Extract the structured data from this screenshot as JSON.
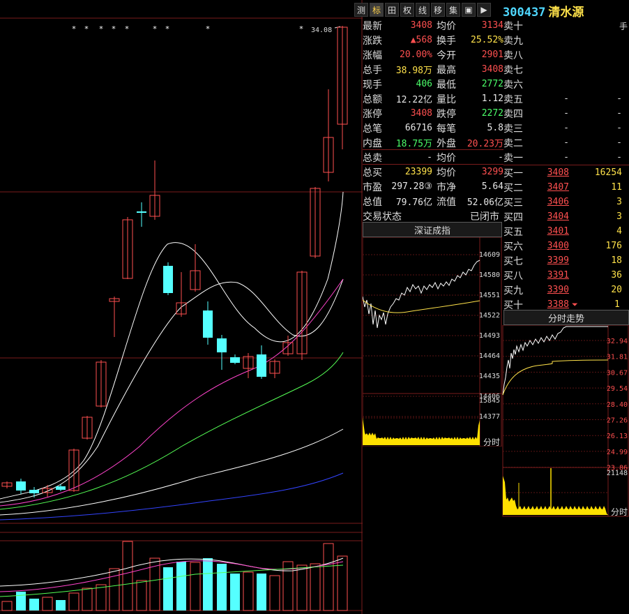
{
  "toolbar": {
    "tabs": [
      "测",
      "标",
      "田",
      "权",
      "线",
      "移",
      "集",
      "▣",
      "▶"
    ],
    "active_tab": "标"
  },
  "stock": {
    "code": "300437",
    "name": "清水源",
    "unit": "手"
  },
  "main_chart": {
    "price_label": "34.08",
    "markers": [
      "*",
      "*",
      "*",
      "*",
      "*",
      "*",
      "*",
      "*",
      "*"
    ]
  },
  "quote": {
    "rows": [
      {
        "l1": "最新",
        "v1": "3408",
        "c1": "red",
        "l2": "均价",
        "v2": "3134",
        "c2": "red"
      },
      {
        "l1": "涨跌",
        "v1": "▲568",
        "c1": "red",
        "l2": "换手",
        "v2": "25.52%",
        "c2": "yellow"
      },
      {
        "l1": "涨幅",
        "v1": "20.00%",
        "c1": "red",
        "l2": "今开",
        "v2": "2901",
        "c2": "red"
      },
      {
        "l1": "总手",
        "v1": "38.98万",
        "c1": "yellow",
        "l2": "最高",
        "v2": "3408",
        "c2": "red"
      },
      {
        "l1": "现手",
        "v1": "406",
        "c1": "green",
        "l2": "最低",
        "v2": "2772",
        "c2": "green"
      },
      {
        "l1": "总额",
        "v1": "12.22亿",
        "c1": "white",
        "l2": "量比",
        "v2": "1.12",
        "c2": "white"
      },
      {
        "l1": "涨停",
        "v1": "3408",
        "c1": "red",
        "l2": "跌停",
        "v2": "2272",
        "c2": "green"
      },
      {
        "l1": "总笔",
        "v1": "66716",
        "c1": "white",
        "l2": "每笔",
        "v2": "5.8",
        "c2": "white"
      },
      {
        "l1": "内盘",
        "v1": "18.75万",
        "c1": "green",
        "l2": "外盘",
        "v2": "20.23万",
        "c2": "red"
      },
      {
        "l1": "总卖",
        "v1": "-",
        "c1": "white",
        "l2": "均价",
        "v2": "-",
        "c2": "white"
      },
      {
        "l1": "总买",
        "v1": "23399",
        "c1": "yellow",
        "l2": "均价",
        "v2": "3299",
        "c2": "red"
      },
      {
        "l1": "市盈",
        "v1": "297.28③",
        "c1": "white",
        "l2": "市净",
        "v2": "5.64",
        "c2": "white"
      },
      {
        "l1": "总值",
        "v1": "79.76亿",
        "c1": "white",
        "l2": "流值",
        "v2": "52.06亿",
        "c2": "white"
      }
    ],
    "trade_state_label": "交易状态",
    "trade_state_value": "已闭市"
  },
  "orderbook": {
    "sell": [
      {
        "label": "卖十",
        "price": "",
        "vol": ""
      },
      {
        "label": "卖九",
        "price": "",
        "vol": ""
      },
      {
        "label": "卖八",
        "price": "",
        "vol": ""
      },
      {
        "label": "卖七",
        "price": "",
        "vol": ""
      },
      {
        "label": "卖六",
        "price": "",
        "vol": ""
      },
      {
        "label": "卖五",
        "price": "-",
        "vol": "-"
      },
      {
        "label": "卖四",
        "price": "-",
        "vol": "-"
      },
      {
        "label": "卖三",
        "price": "-",
        "vol": "-"
      },
      {
        "label": "卖二",
        "price": "-",
        "vol": "-"
      },
      {
        "label": "卖一",
        "price": "-",
        "vol": "-"
      }
    ],
    "buy": [
      {
        "label": "买一",
        "price": "3408",
        "vol": "16254"
      },
      {
        "label": "买二",
        "price": "3407",
        "vol": "11"
      },
      {
        "label": "买三",
        "price": "3406",
        "vol": "3"
      },
      {
        "label": "买四",
        "price": "3404",
        "vol": "3"
      },
      {
        "label": "买五",
        "price": "3401",
        "vol": "4"
      },
      {
        "label": "买六",
        "price": "3400",
        "vol": "176"
      },
      {
        "label": "买七",
        "price": "3399",
        "vol": "18"
      },
      {
        "label": "买八",
        "price": "3391",
        "vol": "36"
      },
      {
        "label": "买九",
        "price": "3390",
        "vol": "20"
      },
      {
        "label": "买十",
        "price": "3388",
        "vol": "1",
        "arrow": "⏷"
      }
    ]
  },
  "index_panel": {
    "title": "深证成指",
    "axis": [
      "14609",
      "14580",
      "14551",
      "14522",
      "14493",
      "14464",
      "14435",
      "14406",
      "14377"
    ],
    "vol_axis": "15845",
    "vol_label": "分时"
  },
  "intraday_panel": {
    "title": "分时走势",
    "axis": [
      "32.94",
      "31.81",
      "30.67",
      "29.54",
      "28.40",
      "27.26",
      "26.13",
      "24.99",
      "23.86"
    ],
    "vol_axis": "21148",
    "vol_label": "分时"
  },
  "colors": {
    "up": "#ff5050",
    "down": "#55ffff",
    "grid": "#7a1c1c",
    "text": "#dddddd",
    "yellow": "#ffe24a"
  }
}
